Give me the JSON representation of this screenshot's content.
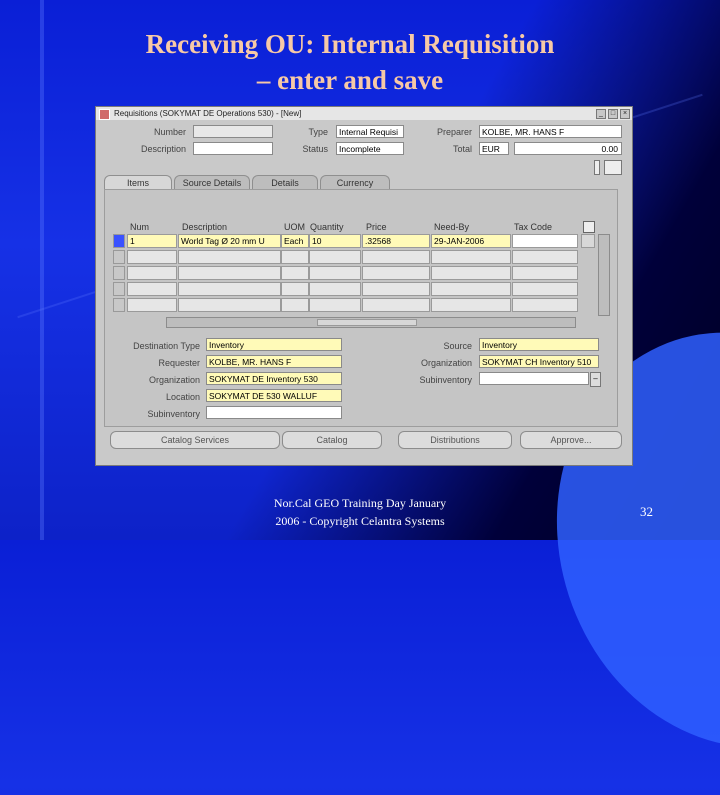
{
  "slide": {
    "title_line1": "Receiving OU: Internal Requisition",
    "title_line2": "– enter and save",
    "footer_line1": "Nor.Cal GEO Training Day January",
    "footer_line2": "2006 - Copyright Celantra Systems",
    "page_number": "32"
  },
  "window": {
    "title": "Requisitions (SOKYMAT DE Operations 530) - [New]",
    "header": {
      "number_label": "Number",
      "number_value": "",
      "type_label": "Type",
      "type_value": "Internal Requisi",
      "preparer_label": "Preparer",
      "preparer_value": "KOLBE, MR. HANS F",
      "description_label": "Description",
      "description_value": "",
      "status_label": "Status",
      "status_value": "Incomplete",
      "total_label": "Total",
      "currency_value": "EUR",
      "total_value": "0.00"
    },
    "tabs": [
      "Items",
      "Source Details",
      "Details",
      "Currency"
    ],
    "columns": {
      "num": "Num",
      "description": "Description",
      "uom": "UOM",
      "quantity": "Quantity",
      "price": "Price",
      "need_by": "Need-By",
      "tax_code": "Tax Code"
    },
    "row1": {
      "num": "1",
      "description": "World Tag Ø 20 mm U",
      "uom": "Each",
      "quantity": "10",
      "price": ".32568",
      "need_by": "29-JAN-2006",
      "tax_code": ""
    },
    "dest": {
      "destination_type_label": "Destination Type",
      "destination_type_value": "Inventory",
      "requester_label": "Requester",
      "requester_value": "KOLBE, MR. HANS F",
      "organization_label": "Organization",
      "organization_value": "SOKYMAT DE Inventory 530",
      "location_label": "Location",
      "location_value": "SOKYMAT DE 530 WALLUF",
      "subinventory_label": "Subinventory",
      "subinventory_value": "",
      "source_label": "Source",
      "source_value": "Inventory",
      "src_org_label": "Organization",
      "src_org_value": "SOKYMAT CH Inventory 510",
      "src_subinv_label": "Subinventory",
      "src_subinv_value": ""
    },
    "buttons": {
      "catalog": "Catalog Services",
      "catalog_short": "Catalog",
      "distributions": "Distributions",
      "approve": "Approve..."
    }
  }
}
